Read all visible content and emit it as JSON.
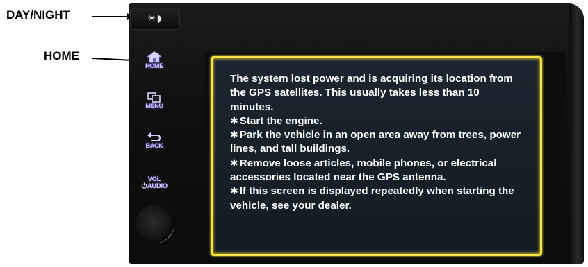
{
  "callouts": {
    "day_night": "DAY/NIGHT",
    "home": "HOME"
  },
  "controls": {
    "day_night_glyph": "☀◗",
    "home_label": "HOME",
    "menu_label": "MENU",
    "back_label": "BACK",
    "vol_label": "VOL",
    "audio_label": "AUDIO"
  },
  "screen": {
    "intro": "The system lost power and is acquiring its location from the GPS satellites. This usually takes less than 10 minutes.",
    "bullets": [
      "Start the engine.",
      "Park the vehicle in an open area away from trees, power lines, and tall buildings.",
      "Remove loose articles, mobile phones, or electrical accessories located near the GPS antenna.",
      "If this screen is displayed repeatedly when starting the vehicle, see your dealer."
    ],
    "bullet_symbol": "✱",
    "border_color": "#f4e24a",
    "text_color": "#ffffff"
  },
  "icons": {
    "day_night": "sun-moon-icon",
    "home": "house-icon",
    "menu": "menu-icon",
    "back": "back-arrow-icon",
    "power": "power-icon"
  }
}
